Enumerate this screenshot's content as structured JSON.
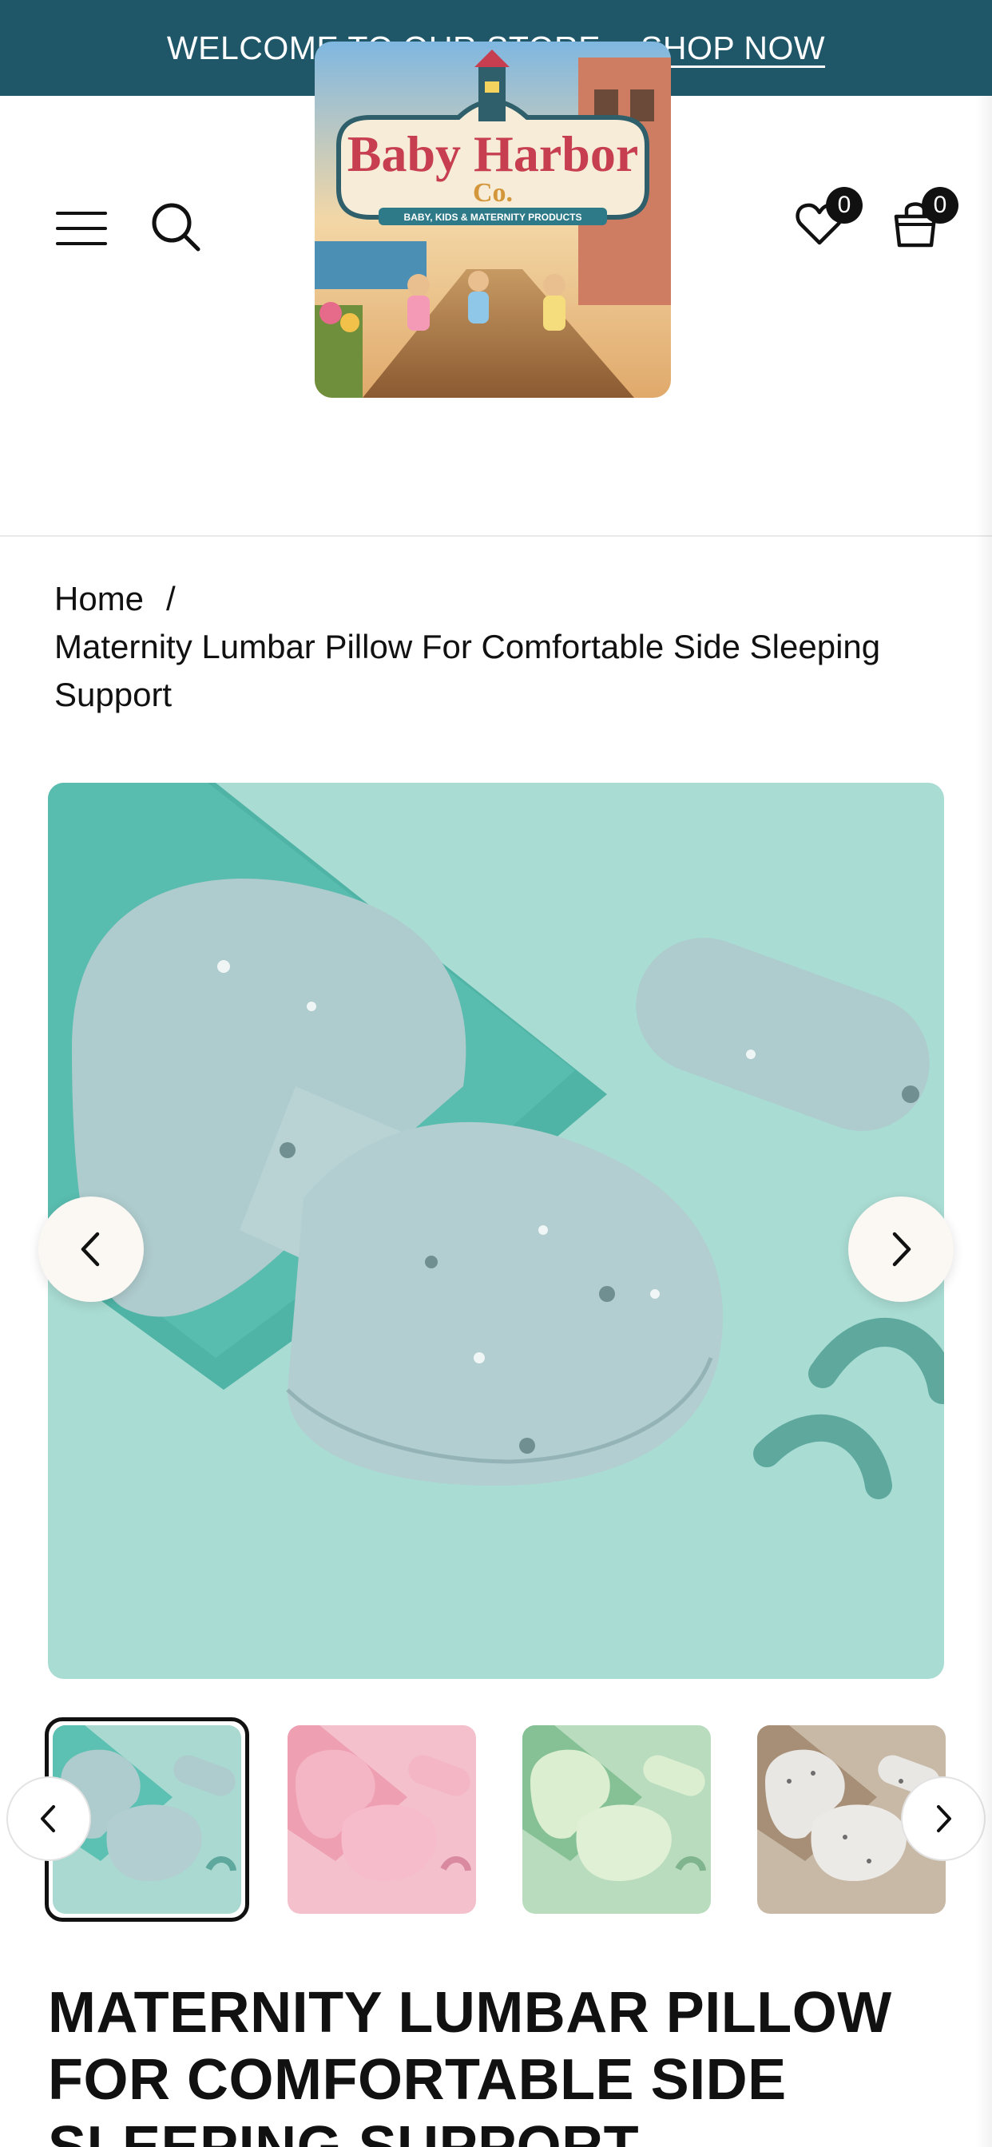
{
  "announcement": {
    "text": "WELCOME TO OUR STORE -",
    "link": "SHOP NOW"
  },
  "header": {
    "menu_icon": "hamburger-menu-icon",
    "search_icon": "search-icon",
    "wishlist_icon": "heart-icon",
    "wishlist_count": "0",
    "cart_icon": "shopping-bag-icon",
    "cart_count": "0",
    "logo": {
      "name_line1": "Baby Harbor",
      "name_line2": "Co.",
      "tagline": "BABY, KIDS & MATERNITY PRODUCTS"
    }
  },
  "breadcrumb": {
    "home": "Home",
    "separator": "/",
    "current": "Maternity Lumbar Pillow For Comfortable Side Sleeping Support"
  },
  "gallery": {
    "prev_icon": "chevron-left-icon",
    "next_icon": "chevron-right-icon",
    "thumbnails": [
      {
        "color": "#a9d9d1",
        "label": "mint"
      },
      {
        "color": "#f3c0cc",
        "label": "pink"
      },
      {
        "color": "#b9dcbf",
        "label": "green"
      },
      {
        "color": "#c8b9a6",
        "label": "beige"
      }
    ]
  },
  "product": {
    "title": "MATERNITY LUMBAR PILLOW FOR COMFORTABLE SIDE SLEEPING SUPPORT"
  },
  "colors": {
    "announcement_bg": "#1f5769",
    "accent_teal": "#3a9e92"
  }
}
